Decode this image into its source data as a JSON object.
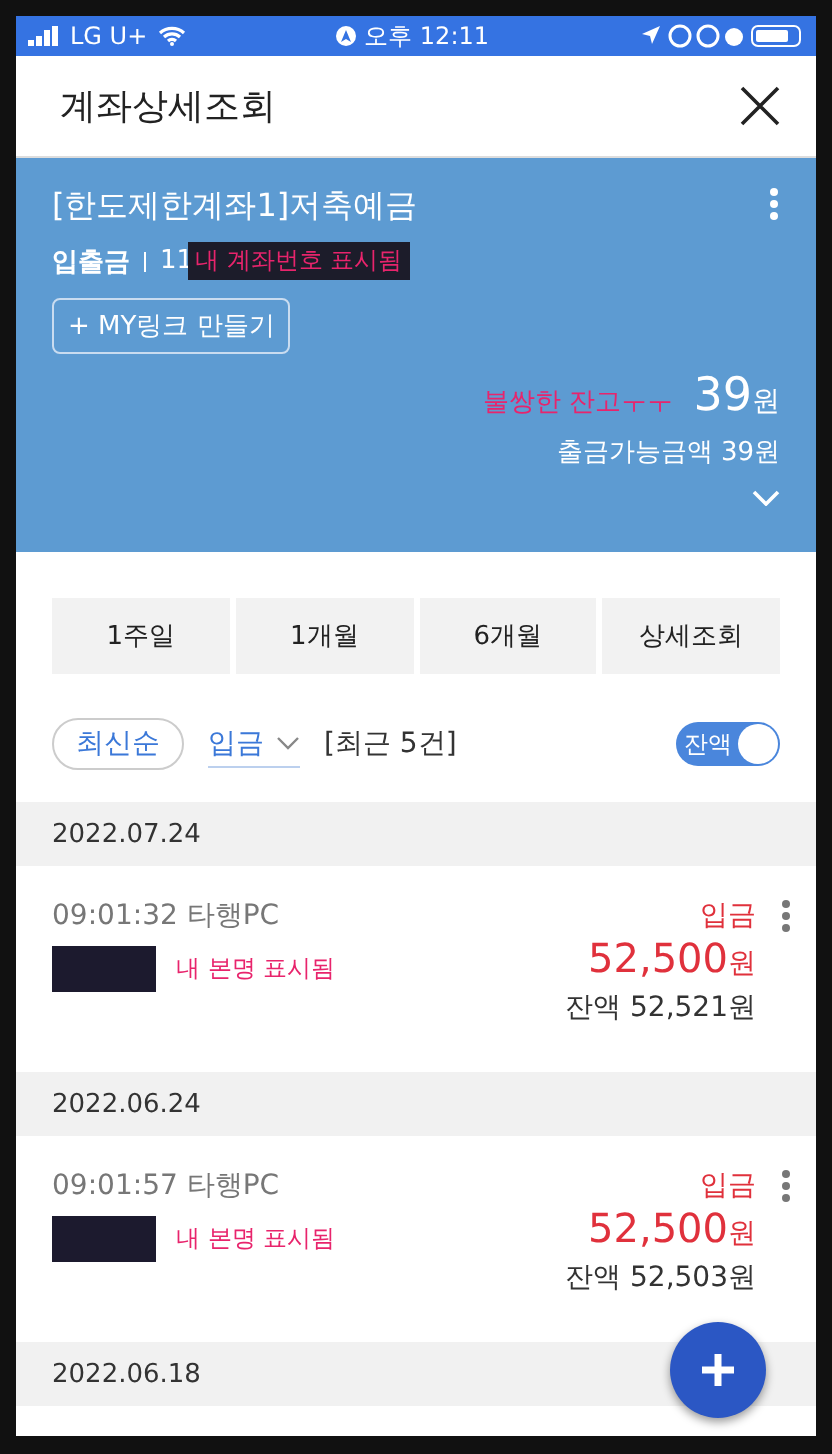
{
  "status_bar": {
    "carrier": "LG U+",
    "time": "오후 12:11"
  },
  "header": {
    "title": "계좌상세조회"
  },
  "account": {
    "name": "[한도제한계좌1]저축예금",
    "type": "입출금",
    "number": "11",
    "number_note": "내 계좌번호 표시됨",
    "link_button": "+ MY링크 만들기",
    "balance_note": "불쌍한 잔고ㅜㅜ",
    "balance": "39",
    "balance_unit": "원",
    "available": "출금가능금액 39원"
  },
  "periods": [
    {
      "label": "1주일"
    },
    {
      "label": "1개월"
    },
    {
      "label": "6개월"
    },
    {
      "label": "상세조회"
    }
  ],
  "filters": {
    "sort": "최신순",
    "type": "입금",
    "count": "[최근 5건]",
    "toggle_label": "잔액",
    "toggle_on": true
  },
  "groups": [
    {
      "date": "2022.07.24",
      "transactions": [
        {
          "time": "09:01:32 타행PC",
          "name_note": "내 본명 표시됨",
          "kind": "입금",
          "amount": "52,500",
          "unit": "원",
          "balance": "잔액 52,521원"
        }
      ]
    },
    {
      "date": "2022.06.24",
      "transactions": [
        {
          "time": "09:01:57 타행PC",
          "name_note": "내 본명 표시됨",
          "kind": "입금",
          "amount": "52,500",
          "unit": "원",
          "balance": "잔액 52,503원"
        }
      ]
    },
    {
      "date": "2022.06.18"
    }
  ]
}
